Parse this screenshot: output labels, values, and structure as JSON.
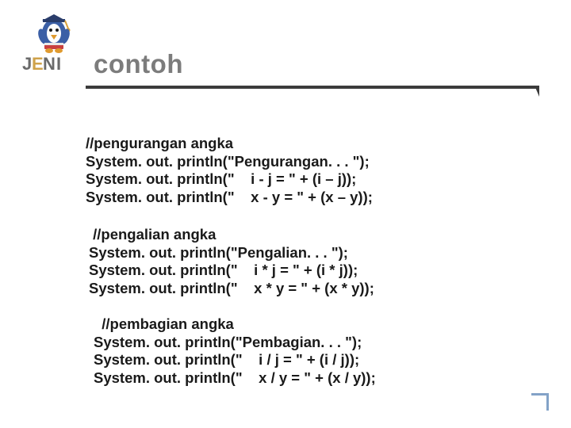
{
  "title": "contoh",
  "block1": {
    "l1": "//pengurangan angka",
    "l2": "System. out. println(\"Pengurangan. . . \");",
    "l3": "System. out. println(\"    i - j = \" + (i – j));",
    "l4": "System. out. println(\"    x - y = \" + (x – y));"
  },
  "block2": {
    "l1": " //pengalian angka",
    "l2": "System. out. println(\"Pengalian. . . \");",
    "l3": "System. out. println(\"    i * j = \" + (i * j));",
    "l4": "System. out. println(\"    x * y = \" + (x * y));"
  },
  "block3": {
    "l1": "  //pembagian angka",
    "l2": "System. out. println(\"Pembagian. . . \");",
    "l3": "System. out. println(\"    i / j = \" + (i / j));",
    "l4": "System. out. println(\"    x / y = \" + (x / y));"
  }
}
